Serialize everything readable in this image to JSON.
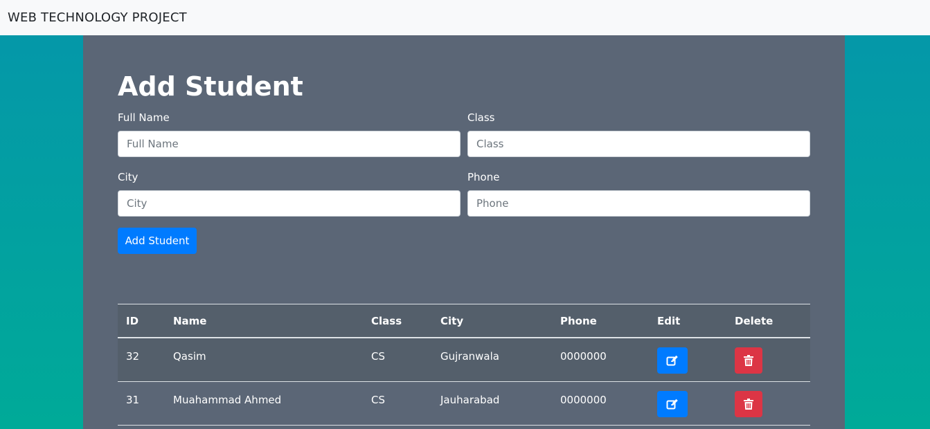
{
  "navbar": {
    "brand": "WEB TECHNOLOGY PROJECT"
  },
  "form": {
    "title": "Add Student",
    "fields": {
      "full_name": {
        "label": "Full Name",
        "placeholder": "Full Name",
        "value": ""
      },
      "class": {
        "label": "Class",
        "placeholder": "Class",
        "value": ""
      },
      "city": {
        "label": "City",
        "placeholder": "City",
        "value": ""
      },
      "phone": {
        "label": "Phone",
        "placeholder": "Phone",
        "value": ""
      }
    },
    "submit_label": "Add Student"
  },
  "table": {
    "headers": [
      "ID",
      "Name",
      "Class",
      "City",
      "Phone",
      "Edit",
      "Delete"
    ],
    "rows": [
      {
        "id": "32",
        "name": "Qasim",
        "class": "CS",
        "city": "Gujranwala",
        "phone": "0000000"
      },
      {
        "id": "31",
        "name": "Muahammad Ahmed",
        "class": "CS",
        "city": "Jauharabad",
        "phone": "0000000"
      }
    ]
  },
  "icons": {
    "edit": "edit-icon",
    "delete": "trash-icon"
  },
  "colors": {
    "primary": "#007bff",
    "danger": "#dc3545",
    "panel": "#5b6676"
  }
}
